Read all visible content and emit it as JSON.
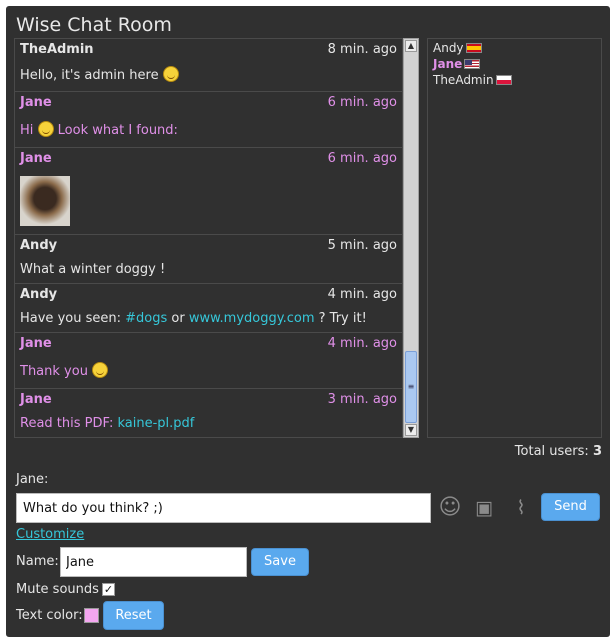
{
  "window": {
    "title": "Wise Chat Room"
  },
  "messages": [
    {
      "sender": "TheAdmin",
      "time": "8 min. ago",
      "text": "Hello, it's admin here",
      "emoticon": "smile-icon"
    },
    {
      "sender": "Jane",
      "time": "6 min. ago",
      "text_before": "Hi",
      "emoticon": "wink-icon",
      "text_after": "Look what I found:"
    },
    {
      "sender": "Jane",
      "time": "6 min. ago",
      "image": "dog-photo"
    },
    {
      "sender": "Andy",
      "time": "5 min. ago",
      "text": "What a winter doggy !"
    },
    {
      "sender": "Andy",
      "time": "4 min. ago",
      "text_before": "Have you seen:",
      "hashtag": "#dogs",
      "text_mid": "or",
      "link": "www.mydoggy.com",
      "text_after": "? Try it!"
    },
    {
      "sender": "Jane",
      "time": "4 min. ago",
      "text": "Thank you",
      "emoticon": "grin-icon"
    },
    {
      "sender": "Jane",
      "time": "3 min. ago",
      "text_before": "Read this PDF:",
      "link": "kaine-pl.pdf"
    }
  ],
  "users": [
    {
      "name": "Andy",
      "flag": "flag-es"
    },
    {
      "name": "Jane",
      "flag": "flag-us"
    },
    {
      "name": "TheAdmin",
      "flag": "flag-pl"
    }
  ],
  "total_users": {
    "label": "Total users:",
    "count": "3"
  },
  "input": {
    "label": "Jane:",
    "value": "What do you think? ;)"
  },
  "buttons": {
    "send": "Send",
    "save": "Save",
    "reset": "Reset"
  },
  "customize": {
    "link": "Customize",
    "name_label": "Name:",
    "name_value": "Jane",
    "mute_label": "Mute sounds",
    "mute_checked": "true",
    "text_color_label": "Text color:",
    "text_color": "#f4a6f0"
  },
  "colors": {
    "background": "#303030",
    "jane": "#e090e8",
    "link": "#36c7d9",
    "button": "#5aa9ee"
  }
}
